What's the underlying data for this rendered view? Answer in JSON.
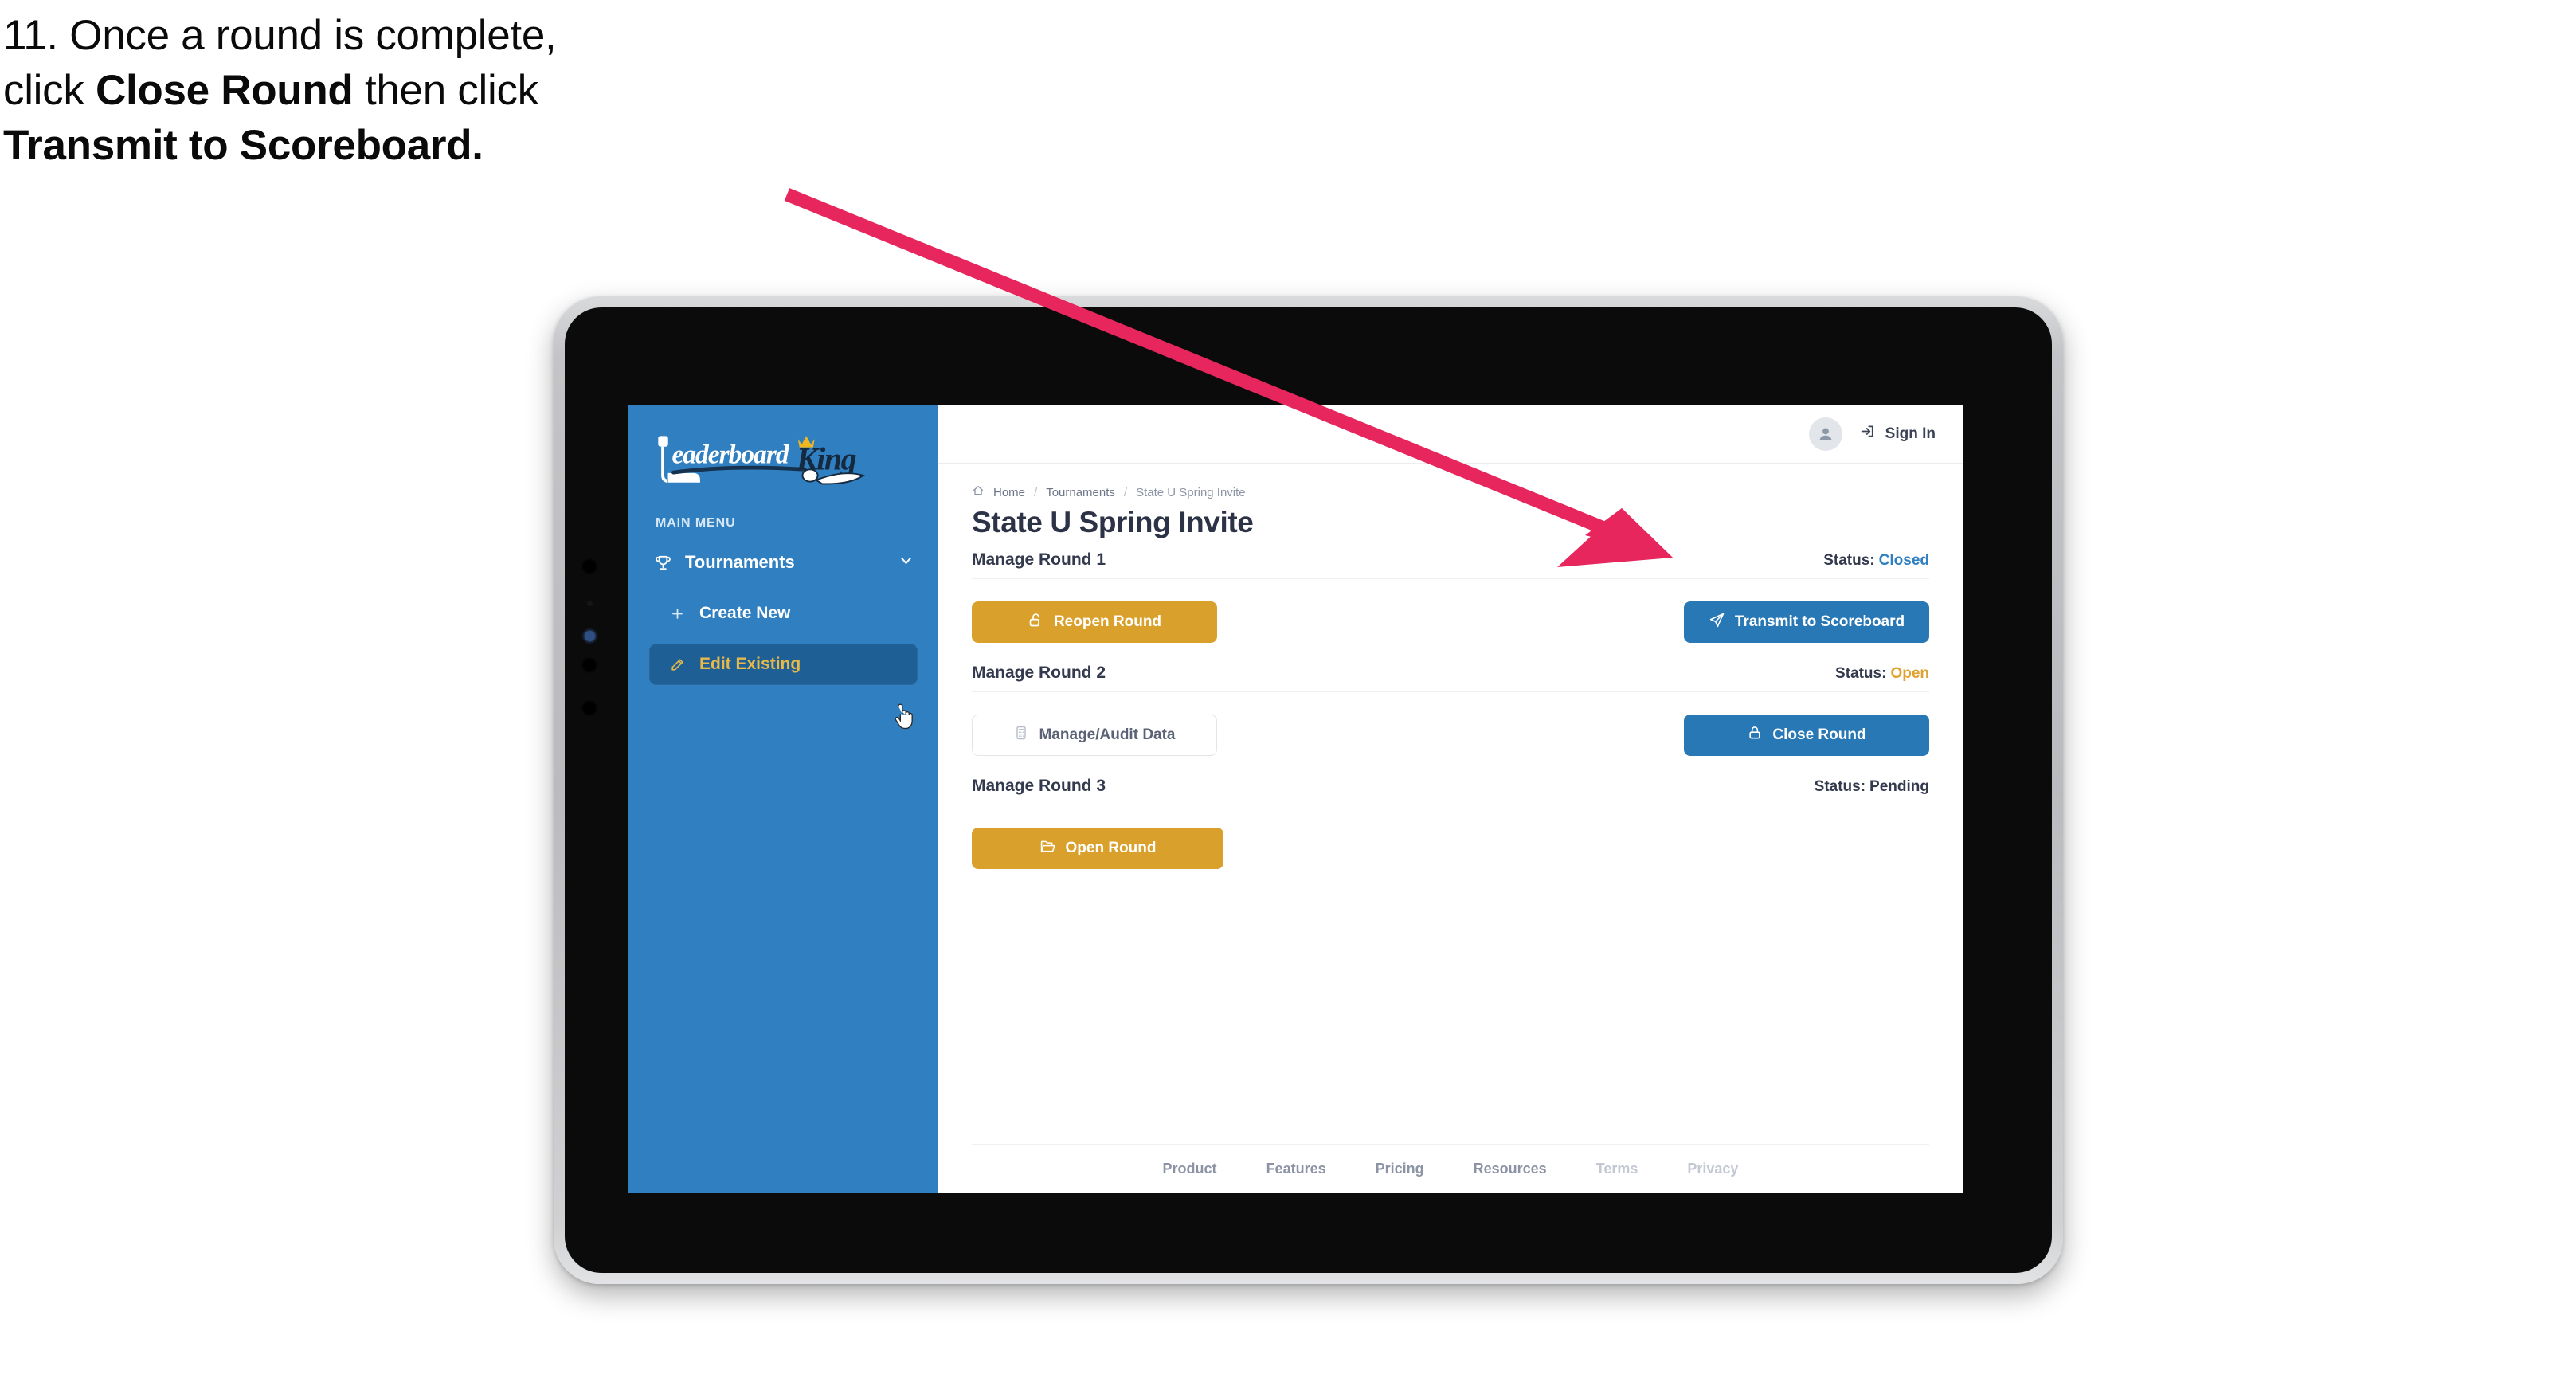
{
  "caption": {
    "line1_prefix": "11. Once a round is complete,",
    "line2_prefix": "click ",
    "line2_bold": "Close Round",
    "line2_suffix": " then click",
    "line3_bold": "Transmit to Scoreboard."
  },
  "annotation": {
    "arrow_color": "#E8265E",
    "arrow_target": "transmit-to-scoreboard-button"
  },
  "app": {
    "topbar": {
      "avatar_icon": "user-avatar-icon",
      "signin_icon": "sign-in-arrow-icon",
      "signin_label": "Sign In"
    },
    "sidebar": {
      "logo_primary": "Leaderboard",
      "logo_secondary": "King",
      "section_label": "MAIN MENU",
      "items": [
        {
          "label": "Tournaments",
          "icon": "trophy-icon",
          "chevron": "chevron-down-icon",
          "active": false
        },
        {
          "label": "Create New",
          "icon": "plus-icon",
          "active": false
        },
        {
          "label": "Edit Existing",
          "icon": "pencil-square-icon",
          "active": true
        }
      ],
      "bg_color": "#2F7FC1",
      "active_bg_color": "#1E6096",
      "active_text_color": "#E8B949"
    },
    "breadcrumb": {
      "home_icon": "home-icon",
      "items": [
        "Home",
        "Tournaments",
        "State U Spring Invite"
      ],
      "separator": "/"
    },
    "page_title": "State U Spring Invite",
    "rounds": [
      {
        "title": "Manage Round 1",
        "status_label": "Status:",
        "status_value": "Closed",
        "status_class": "st-closed",
        "left_button": {
          "label": "Reopen Round",
          "icon": "unlock-icon",
          "style": "gold"
        },
        "right_button": {
          "label": "Transmit to Scoreboard",
          "icon": "paper-plane-icon",
          "style": "blue"
        }
      },
      {
        "title": "Manage Round 2",
        "status_label": "Status:",
        "status_value": "Open",
        "status_class": "st-open",
        "left_button": {
          "label": "Manage/Audit Data",
          "icon": "calculator-icon",
          "style": "ghost"
        },
        "right_button": {
          "label": "Close Round",
          "icon": "lock-icon",
          "style": "blue"
        }
      },
      {
        "title": "Manage Round 3",
        "status_label": "Status:",
        "status_value": "Pending",
        "status_class": "st-pending",
        "left_button": {
          "label": "Open Round",
          "icon": "folder-open-icon",
          "style": "gold"
        },
        "right_button": null
      }
    ],
    "footer_links": [
      {
        "label": "Product",
        "dim": false
      },
      {
        "label": "Features",
        "dim": false
      },
      {
        "label": "Pricing",
        "dim": false
      },
      {
        "label": "Resources",
        "dim": false
      },
      {
        "label": "Terms",
        "dim": true
      },
      {
        "label": "Privacy",
        "dim": true
      }
    ]
  }
}
